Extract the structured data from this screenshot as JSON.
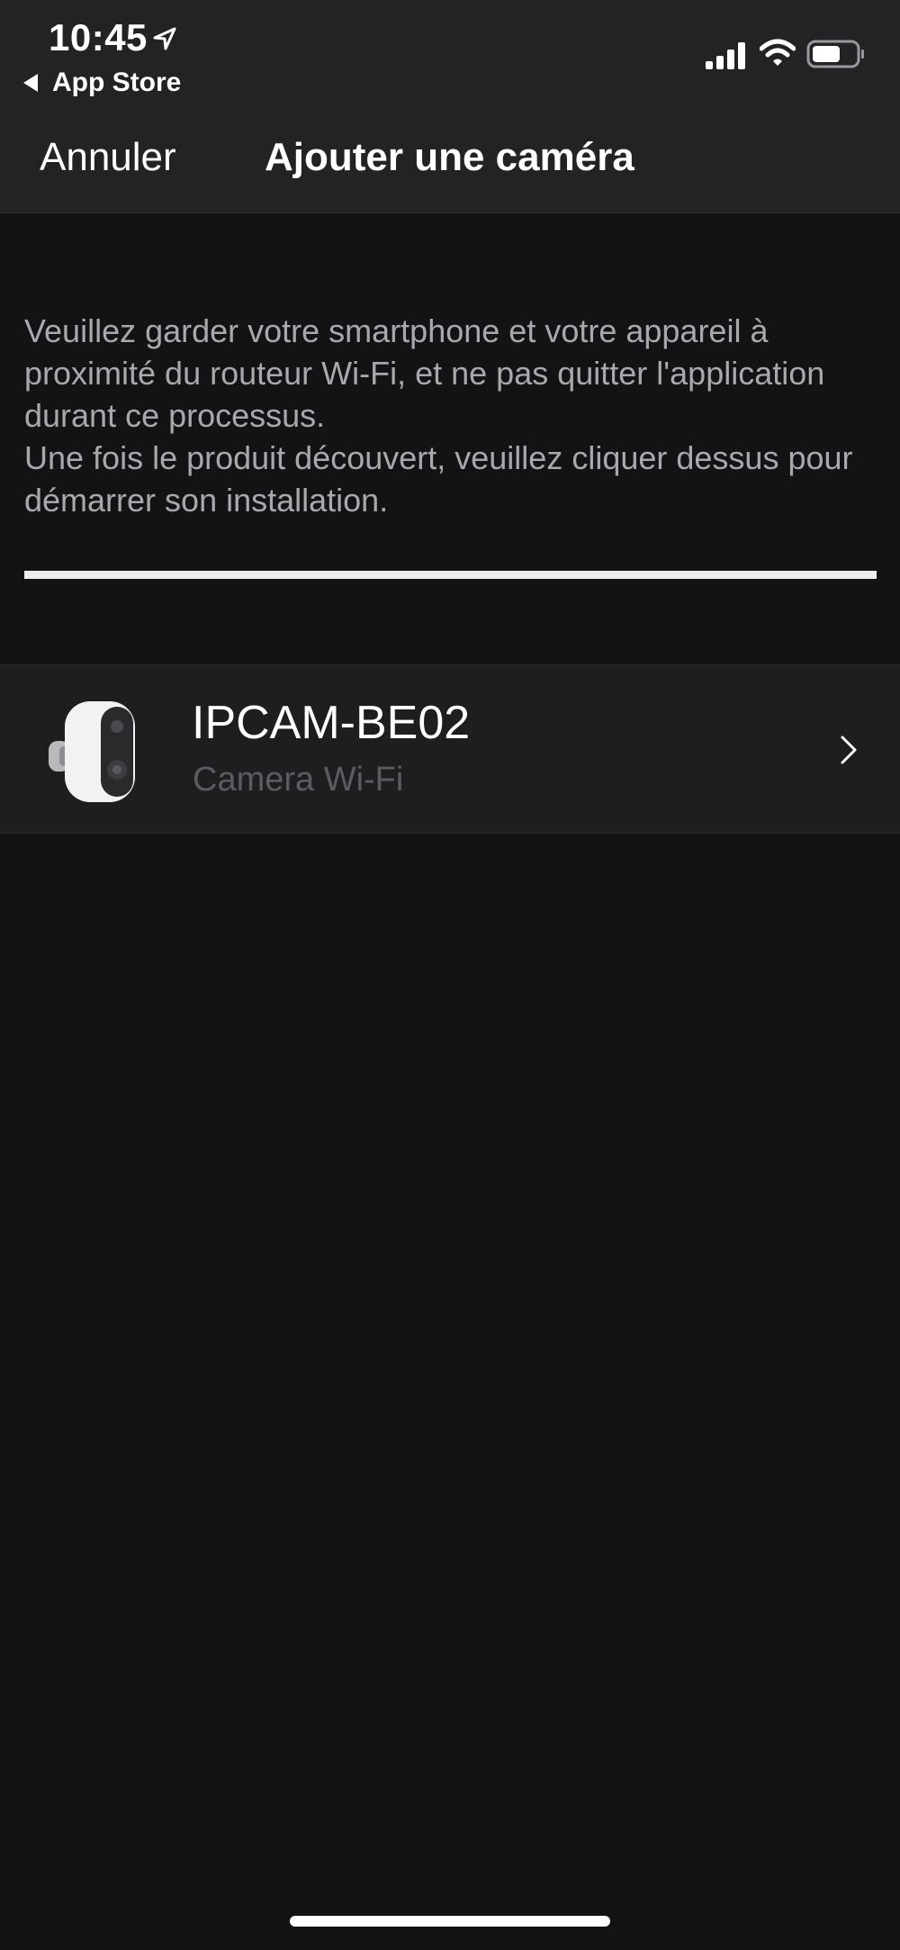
{
  "status_bar": {
    "time": "10:45",
    "back_app": "App Store",
    "icons": [
      "location-icon",
      "signal-icon",
      "wifi-icon",
      "battery-icon"
    ]
  },
  "nav": {
    "cancel_label": "Annuler",
    "title": "Ajouter une caméra"
  },
  "instructions": {
    "line1": "Veuillez garder votre smartphone et votre appareil à proximité du routeur Wi-Fi, et ne pas quitter l'application durant ce processus.",
    "line2": "Une fois le produit découvert, veuillez cliquer dessus pour démarrer son installation."
  },
  "progress": {
    "value": 1.0
  },
  "devices": [
    {
      "name": "IPCAM-BE02",
      "type": "Camera Wi-Fi",
      "icon": "camera-thumbnail"
    }
  ],
  "colors": {
    "background": "#131315",
    "topbar": "#232326",
    "row": "#1e1e21",
    "instruction_text": "#a9a9ad",
    "secondary_text": "#5c5c60"
  }
}
